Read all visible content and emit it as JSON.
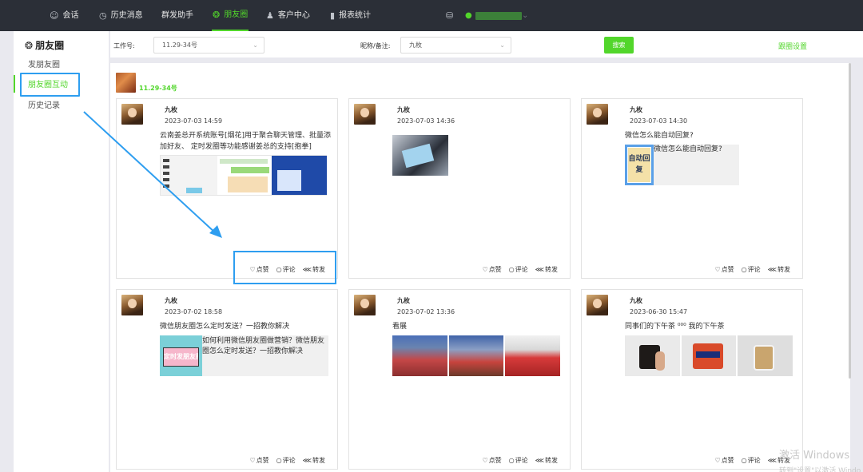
{
  "nav": {
    "items": [
      {
        "label": "会话",
        "icon": "chat-icon"
      },
      {
        "label": "历史消息",
        "icon": "clock-icon"
      },
      {
        "label": "群发助手",
        "icon": ""
      },
      {
        "label": "朋友圈",
        "icon": "moments-icon"
      },
      {
        "label": "客户中心",
        "icon": "user-icon"
      },
      {
        "label": "报表统计",
        "icon": "bar-chart-icon"
      }
    ],
    "active": "朋友圈"
  },
  "sidebar": {
    "title": "朋友圈",
    "items": [
      {
        "label": "发朋友圈"
      },
      {
        "label": "朋友圈互动"
      },
      {
        "label": "历史记录"
      }
    ],
    "active": "朋友圈互动"
  },
  "filter": {
    "work_label": "工作号:",
    "work_value": "11.29-34号",
    "nick_label": "昵称/备注:",
    "nick_value": "九枚",
    "search_label": "搜索",
    "follow_label": "跟圈设置"
  },
  "account": {
    "name": "11.29-34号"
  },
  "actions": {
    "like": "点赞",
    "comment": "评论",
    "forward": "转发"
  },
  "posts": [
    {
      "name": "九枚",
      "time": "2023-07-03 14:59",
      "text": "云南姜总开系统账号[烟花]用于聚合聊天管理、批量添加好友、 定时发圈等功能感谢姜总的支持[抱拳]"
    },
    {
      "name": "九枚",
      "time": "2023-07-03 14:36",
      "text": ""
    },
    {
      "name": "九枚",
      "time": "2023-07-03 14:30",
      "text": "微信怎么能自动回复?",
      "share_text": "微信怎么能自动回复?",
      "share_thumb_text": "自动回复"
    },
    {
      "name": "九枚",
      "time": "2023-07-02 18:58",
      "text": "微信朋友圈怎么定时发送？一招教你解决",
      "share_text": "如何利用微信朋友圈做营销？微信朋友圈怎么定时发送？一招教你解决",
      "share_thumb_text": "定时发朋友圈"
    },
    {
      "name": "九枚",
      "time": "2023-07-02 13:36",
      "text": "看展"
    },
    {
      "name": "九枚",
      "time": "2023-06-30 15:47",
      "text": "同事们的下午茶 ⁰⁰⁰ 我的下午茶"
    }
  ],
  "watermark": {
    "line1": "激活 Windows",
    "line2": "转到\"设置\"以激活 Windo"
  },
  "colors": {
    "accent": "#52d62b",
    "nav_bg": "#2b2f37",
    "annotation": "#2e9ef0"
  }
}
